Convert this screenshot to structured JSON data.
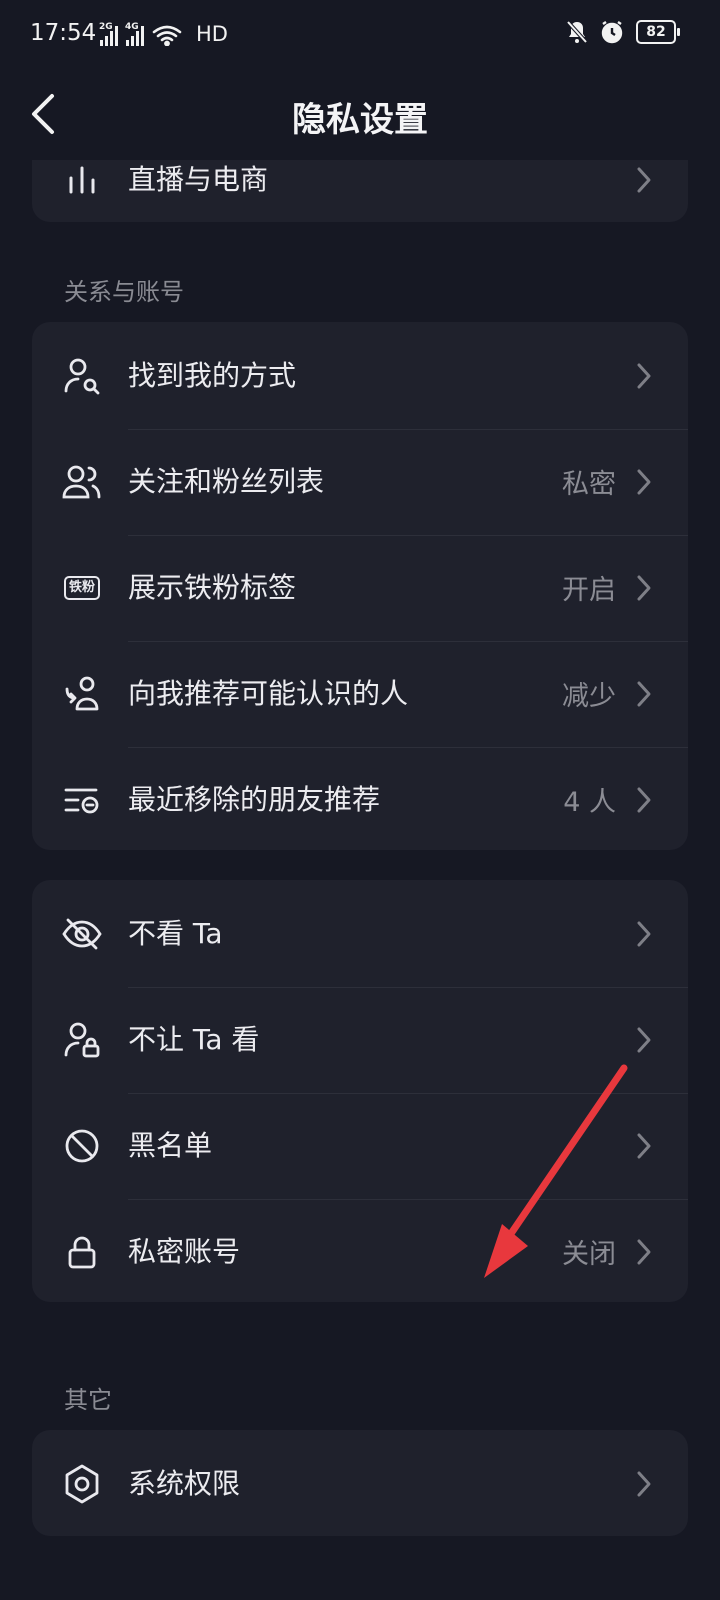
{
  "status_bar": {
    "time": "17:54",
    "net1": "2G",
    "net2": "4G",
    "hd": "HD",
    "battery": "82"
  },
  "header": {
    "title": "隐私设置"
  },
  "top_card": {
    "label": "直播与电商"
  },
  "section_relations": {
    "title": "关系与账号"
  },
  "relations_items": [
    {
      "label": "找到我的方式",
      "value": "",
      "icon": "user-search-icon"
    },
    {
      "label": "关注和粉丝列表",
      "value": "私密",
      "icon": "users-icon"
    },
    {
      "label": "展示铁粉标签",
      "value": "开启",
      "icon": "fan-badge-icon",
      "badge_text": "铁粉"
    },
    {
      "label": "向我推荐可能认识的人",
      "value": "减少",
      "icon": "recommend-people-icon"
    },
    {
      "label": "最近移除的朋友推荐",
      "value": "4 人",
      "icon": "removed-list-icon"
    }
  ],
  "block_items": [
    {
      "label": "不看 Ta",
      "value": "",
      "icon": "eye-off-icon"
    },
    {
      "label": "不让 Ta 看",
      "value": "",
      "icon": "user-lock-icon"
    },
    {
      "label": "黑名单",
      "value": "",
      "icon": "ban-icon"
    },
    {
      "label": "私密账号",
      "value": "关闭",
      "icon": "lock-icon"
    }
  ],
  "section_other": {
    "title": "其它"
  },
  "other_items": [
    {
      "label": "系统权限",
      "value": "",
      "icon": "hexagon-settings-icon"
    }
  ],
  "colors": {
    "background": "#161823",
    "card": "#1f212c",
    "text": "#ececf0",
    "muted": "#8b8c94",
    "arrow": "#e8383d"
  }
}
